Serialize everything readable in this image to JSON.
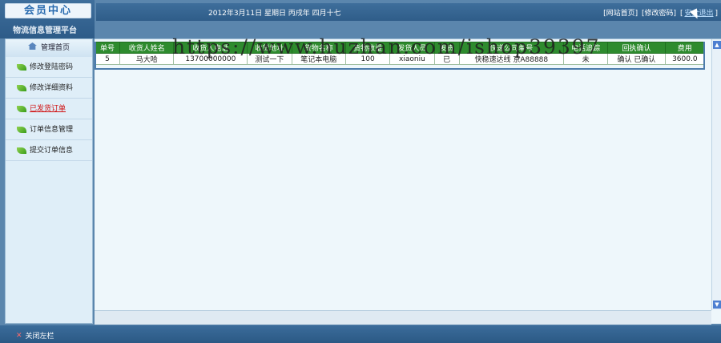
{
  "header": {
    "logo_text": "会员中心",
    "platform_title": "物流信息管理平台",
    "date_text": "2012年3月11日 星期日 丙戌年 四月十七",
    "links": [
      "[网站首页]",
      "[修改密码]",
      "["
    ],
    "logout": "安全退出",
    "logout_close": "]"
  },
  "sidebar": {
    "head": "管理首页",
    "items": [
      {
        "label": "修改登陆密码"
      },
      {
        "label": "修改详细资料"
      },
      {
        "label": "已发货订单",
        "active": true
      },
      {
        "label": "订单信息管理"
      },
      {
        "label": "提交订单信息"
      }
    ]
  },
  "table": {
    "headers": [
      "单号",
      "收货人姓名",
      "收货人电话",
      "收货地址",
      "货物名称",
      "货物数量",
      "发货人员",
      "发货",
      "快递公司单号",
      "电话追踪",
      "回执确认",
      "费用"
    ],
    "rows": [
      [
        "5",
        "马大哈",
        "13700000000",
        "测试一下",
        "笔记本电脑",
        "100",
        "xiaoniu",
        "已",
        "快稳速达线 京A88888",
        "未",
        "确认 已确认",
        "3600.0"
      ]
    ]
  },
  "watermark": "https://www.huzhan.com/ishop39397",
  "footer": {
    "close_left": "关闭左栏"
  },
  "colors": {
    "header_bg": "#2f5d89",
    "table_header": "#2e8b2e",
    "active_item": "#d01010",
    "content_bg": "#eef7fb"
  },
  "icons": {
    "menu_item": "leaf-icon",
    "home": "house-icon",
    "close": "close-x-icon"
  }
}
